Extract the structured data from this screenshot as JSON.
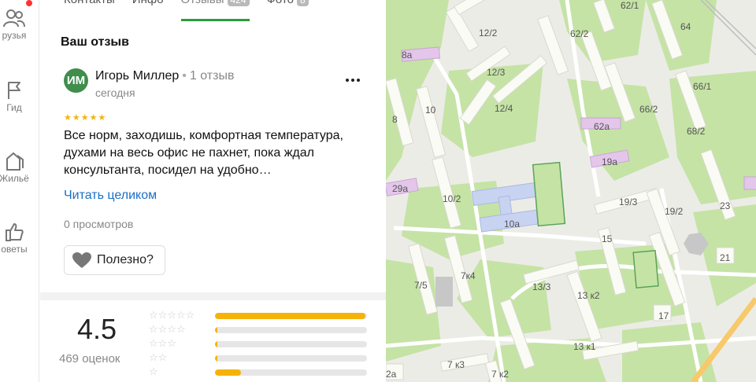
{
  "rail": {
    "items": [
      {
        "label": "рузья"
      },
      {
        "label": "Гид"
      },
      {
        "label": "Жильё"
      },
      {
        "label": "оветы"
      }
    ]
  },
  "tabs": [
    {
      "label": "Контакты"
    },
    {
      "label": "Инфо"
    },
    {
      "label": "Отзывы",
      "badge": "424",
      "active": true
    },
    {
      "label": "Фото",
      "badge": "8"
    }
  ],
  "review": {
    "section_title": "Ваш отзыв",
    "avatar_initials": "ИМ",
    "author": "Игорь Миллер",
    "author_reviews": "1 отзыв",
    "date": "сегодня",
    "rating": 5,
    "text": "Все норм, заходишь, комфортная температура, духами на весь офис не пахнет, пока ждал консультанта, посидел на удобно…",
    "read_more": "Читать целиком",
    "views": "0 просмотров",
    "useful_label": "Полезно?"
  },
  "rating_summary": {
    "score": "4.5",
    "count_label": "469 оценок",
    "distribution": [
      {
        "stars": 5,
        "fraction": 0.99
      },
      {
        "stars": 4,
        "fraction": 0.015
      },
      {
        "stars": 3,
        "fraction": 0.01
      },
      {
        "stars": 2,
        "fraction": 0.015
      },
      {
        "stars": 1,
        "fraction": 0.17
      }
    ]
  },
  "map": {
    "labels": [
      "8а",
      "12/2",
      "12/3",
      "12/4",
      "62/2",
      "62/1",
      "64",
      "66/1",
      "66/2",
      "62а",
      "68/2",
      "19а",
      "8",
      "10",
      "29а",
      "10/2",
      "10а",
      "19/3",
      "19/2",
      "23",
      "15",
      "21",
      "7/5",
      "7к4",
      "13/3",
      "13 к2",
      "17",
      "13 к1",
      "7 к3",
      "7 к2",
      "2а"
    ],
    "colors": {
      "background": "#ecece7",
      "green": "#c5e3a5",
      "building": "#fbfbf5",
      "school": "#c8d3f2",
      "purple": "#e3c6ea",
      "road_orange": "#f7c96a"
    }
  }
}
